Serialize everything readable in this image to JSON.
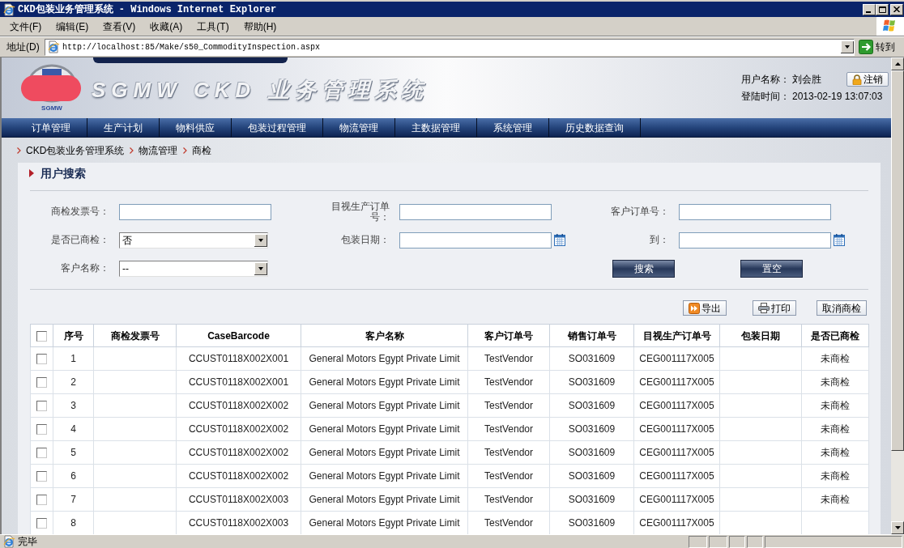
{
  "window": {
    "title": "CKD包装业务管理系统 - Windows Internet Explorer"
  },
  "menu_bar": [
    "文件(F)",
    "编辑(E)",
    "查看(V)",
    "收藏(A)",
    "工具(T)",
    "帮助(H)"
  ],
  "address_bar": {
    "label": "地址(D)",
    "url": "http://localhost:85/Make/s50_CommodityInspection.aspx",
    "go_button": "转到"
  },
  "header": {
    "logo_caption": "SGMW",
    "banner_title": "SGMW CKD 业务管理系统",
    "user": {
      "label": "用户名称：",
      "value": "刘会胜"
    },
    "login_time": {
      "label": "登陆时间：",
      "value": "2013-02-19 13:07:03"
    },
    "logout_button": "注销"
  },
  "nav": [
    "订单管理",
    "生产计划",
    "物料供应",
    "包装过程管理",
    "物流管理",
    "主数据管理",
    "系统管理",
    "历史数据查询"
  ],
  "breadcrumb": [
    "CKD包装业务管理系统",
    "物流管理",
    "商检"
  ],
  "search_panel": {
    "title": "用户搜索",
    "fields": [
      {
        "kind": "text",
        "label": "商检发票号："
      },
      {
        "kind": "text",
        "label": "目视生产订单号："
      },
      {
        "kind": "text",
        "label": "客户订单号："
      },
      {
        "kind": "select",
        "label": "是否已商检：",
        "value": "否"
      },
      {
        "kind": "date",
        "label": "包装日期："
      },
      {
        "kind": "date",
        "label": "到："
      },
      {
        "kind": "select",
        "label": "客户名称：",
        "value": "--"
      }
    ],
    "buttons": [
      "搜索",
      "置空"
    ]
  },
  "toolbar": [
    {
      "kind": "export",
      "label": "导出"
    },
    {
      "kind": "print",
      "label": "打印"
    },
    {
      "kind": "plain",
      "label": "取消商检"
    }
  ],
  "table": {
    "select_all": {
      "checked": false
    },
    "columns": [
      "序号",
      "商检发票号",
      "CaseBarcode",
      "客户名称",
      "客户订单号",
      "销售订单号",
      "目视生产订单号",
      "包装日期",
      "是否已商检"
    ],
    "rows": [
      {
        "checked": false,
        "no": "1",
        "case_barcode": "CCUST0118X002X001",
        "customer_name": "General Motors Egypt Private Limit",
        "customer_order_no": "TestVendor",
        "sales_order_no": "SO031609",
        "visual_order_no": "CEG001117X005",
        "status": "未商检"
      },
      {
        "checked": false,
        "no": "2",
        "case_barcode": "CCUST0118X002X001",
        "customer_name": "General Motors Egypt Private Limit",
        "customer_order_no": "TestVendor",
        "sales_order_no": "SO031609",
        "visual_order_no": "CEG001117X005",
        "status": "未商检"
      },
      {
        "checked": false,
        "no": "3",
        "case_barcode": "CCUST0118X002X002",
        "customer_name": "General Motors Egypt Private Limit",
        "customer_order_no": "TestVendor",
        "sales_order_no": "SO031609",
        "visual_order_no": "CEG001117X005",
        "status": "未商检"
      },
      {
        "checked": false,
        "no": "4",
        "case_barcode": "CCUST0118X002X002",
        "customer_name": "General Motors Egypt Private Limit",
        "customer_order_no": "TestVendor",
        "sales_order_no": "SO031609",
        "visual_order_no": "CEG001117X005",
        "status": "未商检"
      },
      {
        "checked": false,
        "no": "5",
        "case_barcode": "CCUST0118X002X002",
        "customer_name": "General Motors Egypt Private Limit",
        "customer_order_no": "TestVendor",
        "sales_order_no": "SO031609",
        "visual_order_no": "CEG001117X005",
        "status": "未商检"
      },
      {
        "checked": false,
        "no": "6",
        "case_barcode": "CCUST0118X002X002",
        "customer_name": "General Motors Egypt Private Limit",
        "customer_order_no": "TestVendor",
        "sales_order_no": "SO031609",
        "visual_order_no": "CEG001117X005",
        "status": "未商检"
      },
      {
        "checked": false,
        "no": "7",
        "case_barcode": "CCUST0118X002X003",
        "customer_name": "General Motors Egypt Private Limit",
        "customer_order_no": "TestVendor",
        "sales_order_no": "SO031609",
        "visual_order_no": "CEG001117X005",
        "status": "未商检"
      },
      {
        "checked": false,
        "no": "8",
        "case_barcode": "CCUST0118X002X003",
        "customer_name": "General Motors Egypt Private Limit",
        "customer_order_no": "TestVendor",
        "sales_order_no": "SO031609",
        "visual_order_no": "CEG001117X005"
      }
    ]
  },
  "status_bar": {
    "text": "完毕"
  }
}
